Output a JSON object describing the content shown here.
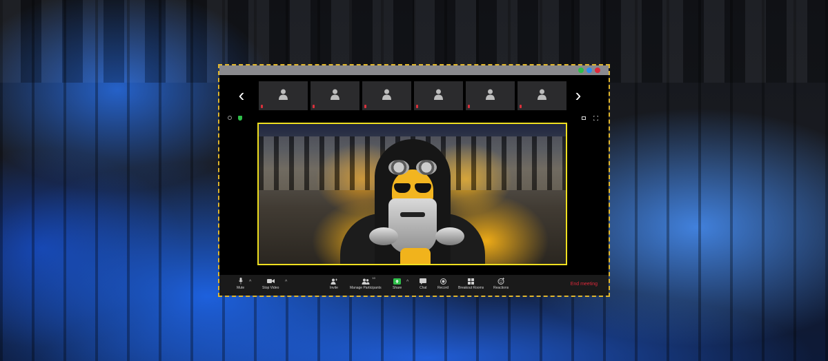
{
  "window": {
    "title_dots": [
      {
        "name": "green",
        "color": "#2fbf4a"
      },
      {
        "name": "blue",
        "color": "#2c8ef0"
      },
      {
        "name": "red",
        "color": "#e0293a"
      }
    ]
  },
  "strip": {
    "prev": "‹",
    "next": "›",
    "tile_count": 6
  },
  "toolbar": {
    "mute": "Mute",
    "stop_video": "Stop Video",
    "invite": "Invite",
    "manage_participants": "Manage Participants",
    "participants_count": "10",
    "share": "Share",
    "chat": "Chat",
    "record": "Record",
    "breakout_rooms": "Breakout Rooms",
    "reactions": "Reactions",
    "end_meeting": "End meeting",
    "caret": "^"
  },
  "colors": {
    "accent_border": "#e2b72c",
    "active_speaker": "#f0e020",
    "share_green": "#2fbf4a",
    "end_red": "#e0293a"
  }
}
